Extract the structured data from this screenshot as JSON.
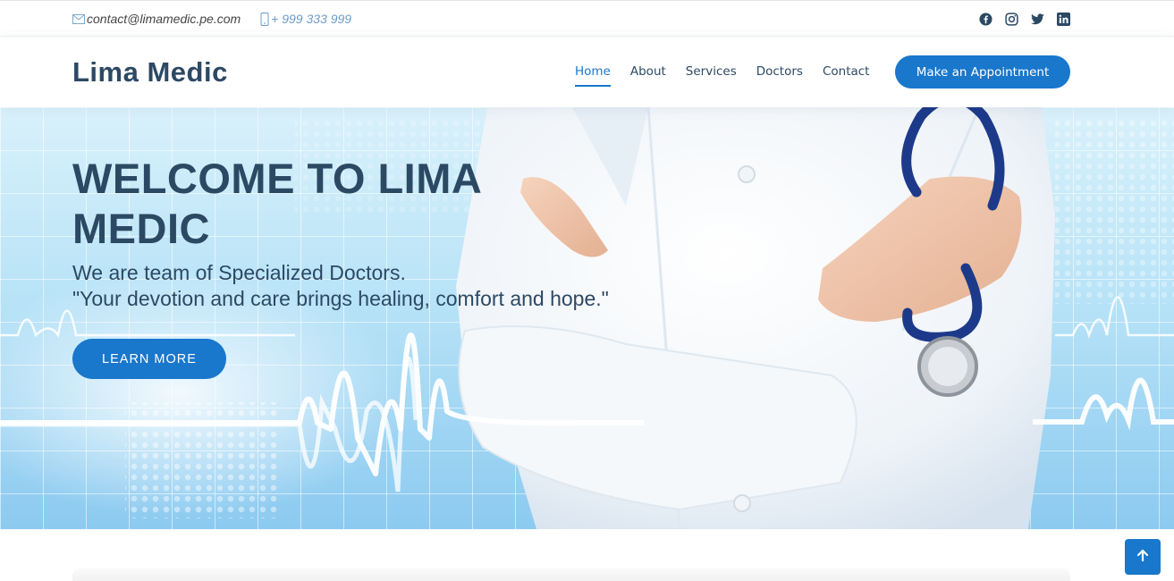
{
  "topbar": {
    "email": "contact@limamedic.pe.com",
    "phone": "+ 999 333 999",
    "social": [
      "facebook-icon",
      "instagram-icon",
      "twitter-icon",
      "linkedin-icon"
    ]
  },
  "header": {
    "logo": "Lima Medic",
    "nav": [
      {
        "label": "Home",
        "active": true
      },
      {
        "label": "About"
      },
      {
        "label": "Services"
      },
      {
        "label": "Doctors"
      },
      {
        "label": "Contact"
      }
    ],
    "appointment_label": "Make an Appointment"
  },
  "hero": {
    "title": "WELCOME TO LIMA MEDIC",
    "subtitle_line1": "We are team of Specialized Doctors.",
    "subtitle_line2": "\"Your devotion and care brings healing, comfort and hope.\"",
    "cta_label": "LEARN MORE"
  },
  "colors": {
    "accent": "#1977cc",
    "text": "#2c4964"
  },
  "icons": {
    "back_to_top": "arrow-up-icon",
    "email": "envelope-icon",
    "phone": "phone-icon"
  }
}
